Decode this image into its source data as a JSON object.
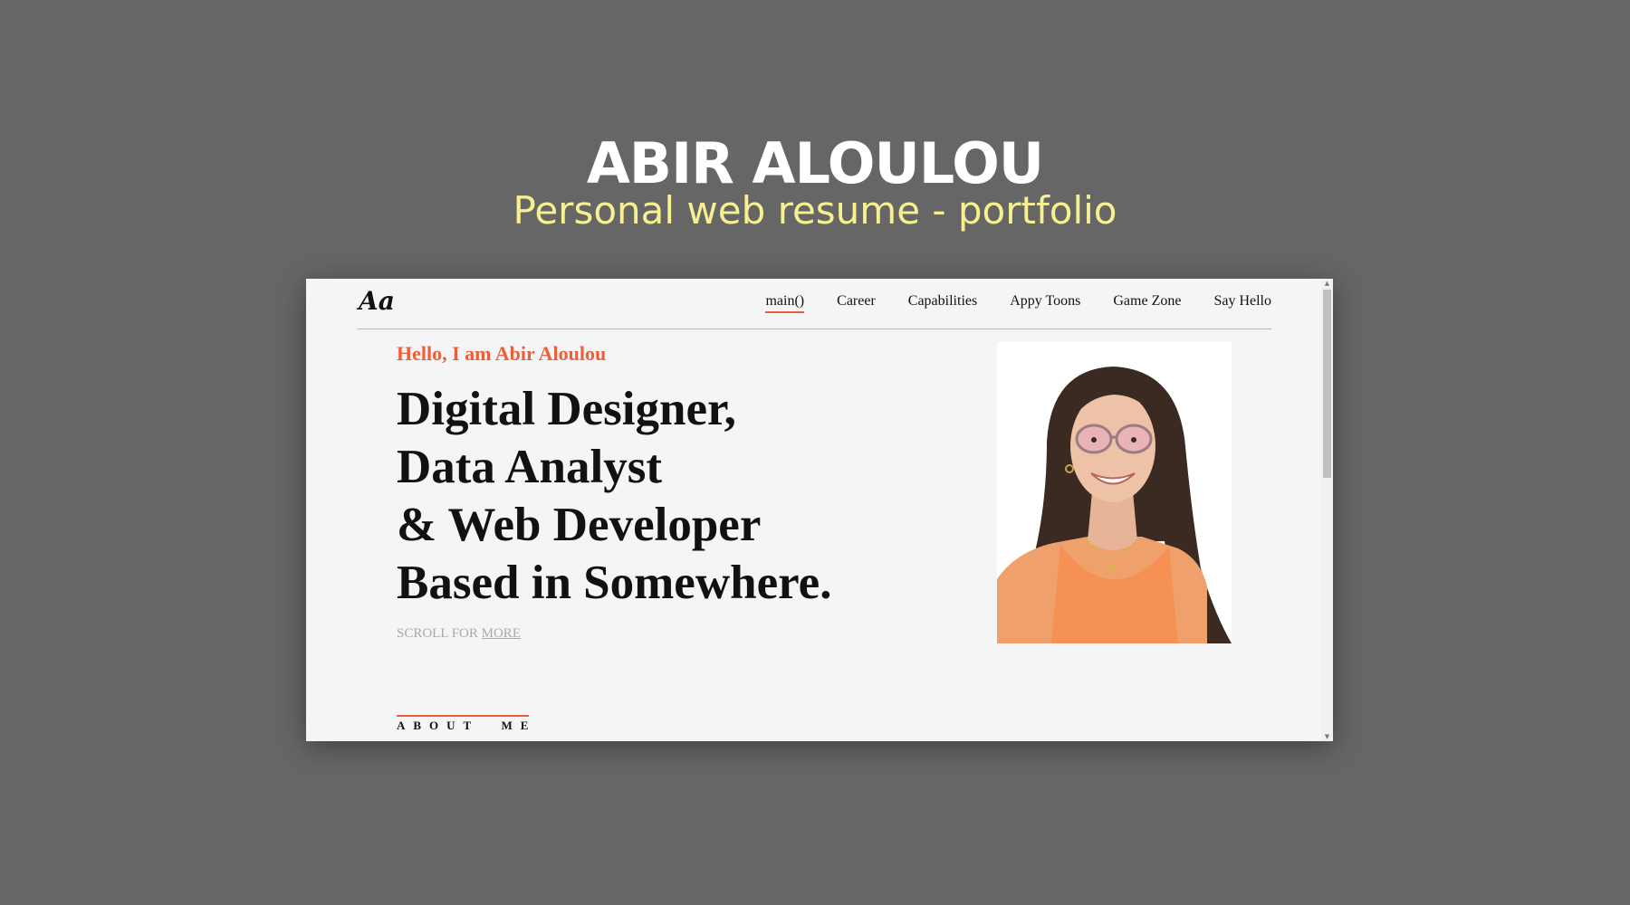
{
  "hero": {
    "title": "ABIR ALOULOU",
    "subtitle": "Personal web resume - portfolio"
  },
  "site": {
    "logo": "Aa",
    "nav": [
      {
        "label": "main()",
        "active": true
      },
      {
        "label": "Career"
      },
      {
        "label": "Capabilities"
      },
      {
        "label": "Appy Toons"
      },
      {
        "label": "Game Zone"
      },
      {
        "label": "Say Hello"
      }
    ],
    "greeting": "Hello, I am Abir Aloulou",
    "headline": [
      "Digital Designer,",
      "Data Analyst",
      "& Web Developer",
      "Based in Somewhere."
    ],
    "scroll_hint": {
      "prefix": "SCROLL FOR ",
      "link": "MORE"
    },
    "about_label": "ABOUT  ME"
  },
  "colors": {
    "background": "#666666",
    "subtitle": "#f7f08f",
    "accent": "#ee5f38",
    "window_bg": "#f4f5f6"
  },
  "icons": {
    "scroll_up": "triangle-up",
    "scroll_down": "triangle-down"
  }
}
